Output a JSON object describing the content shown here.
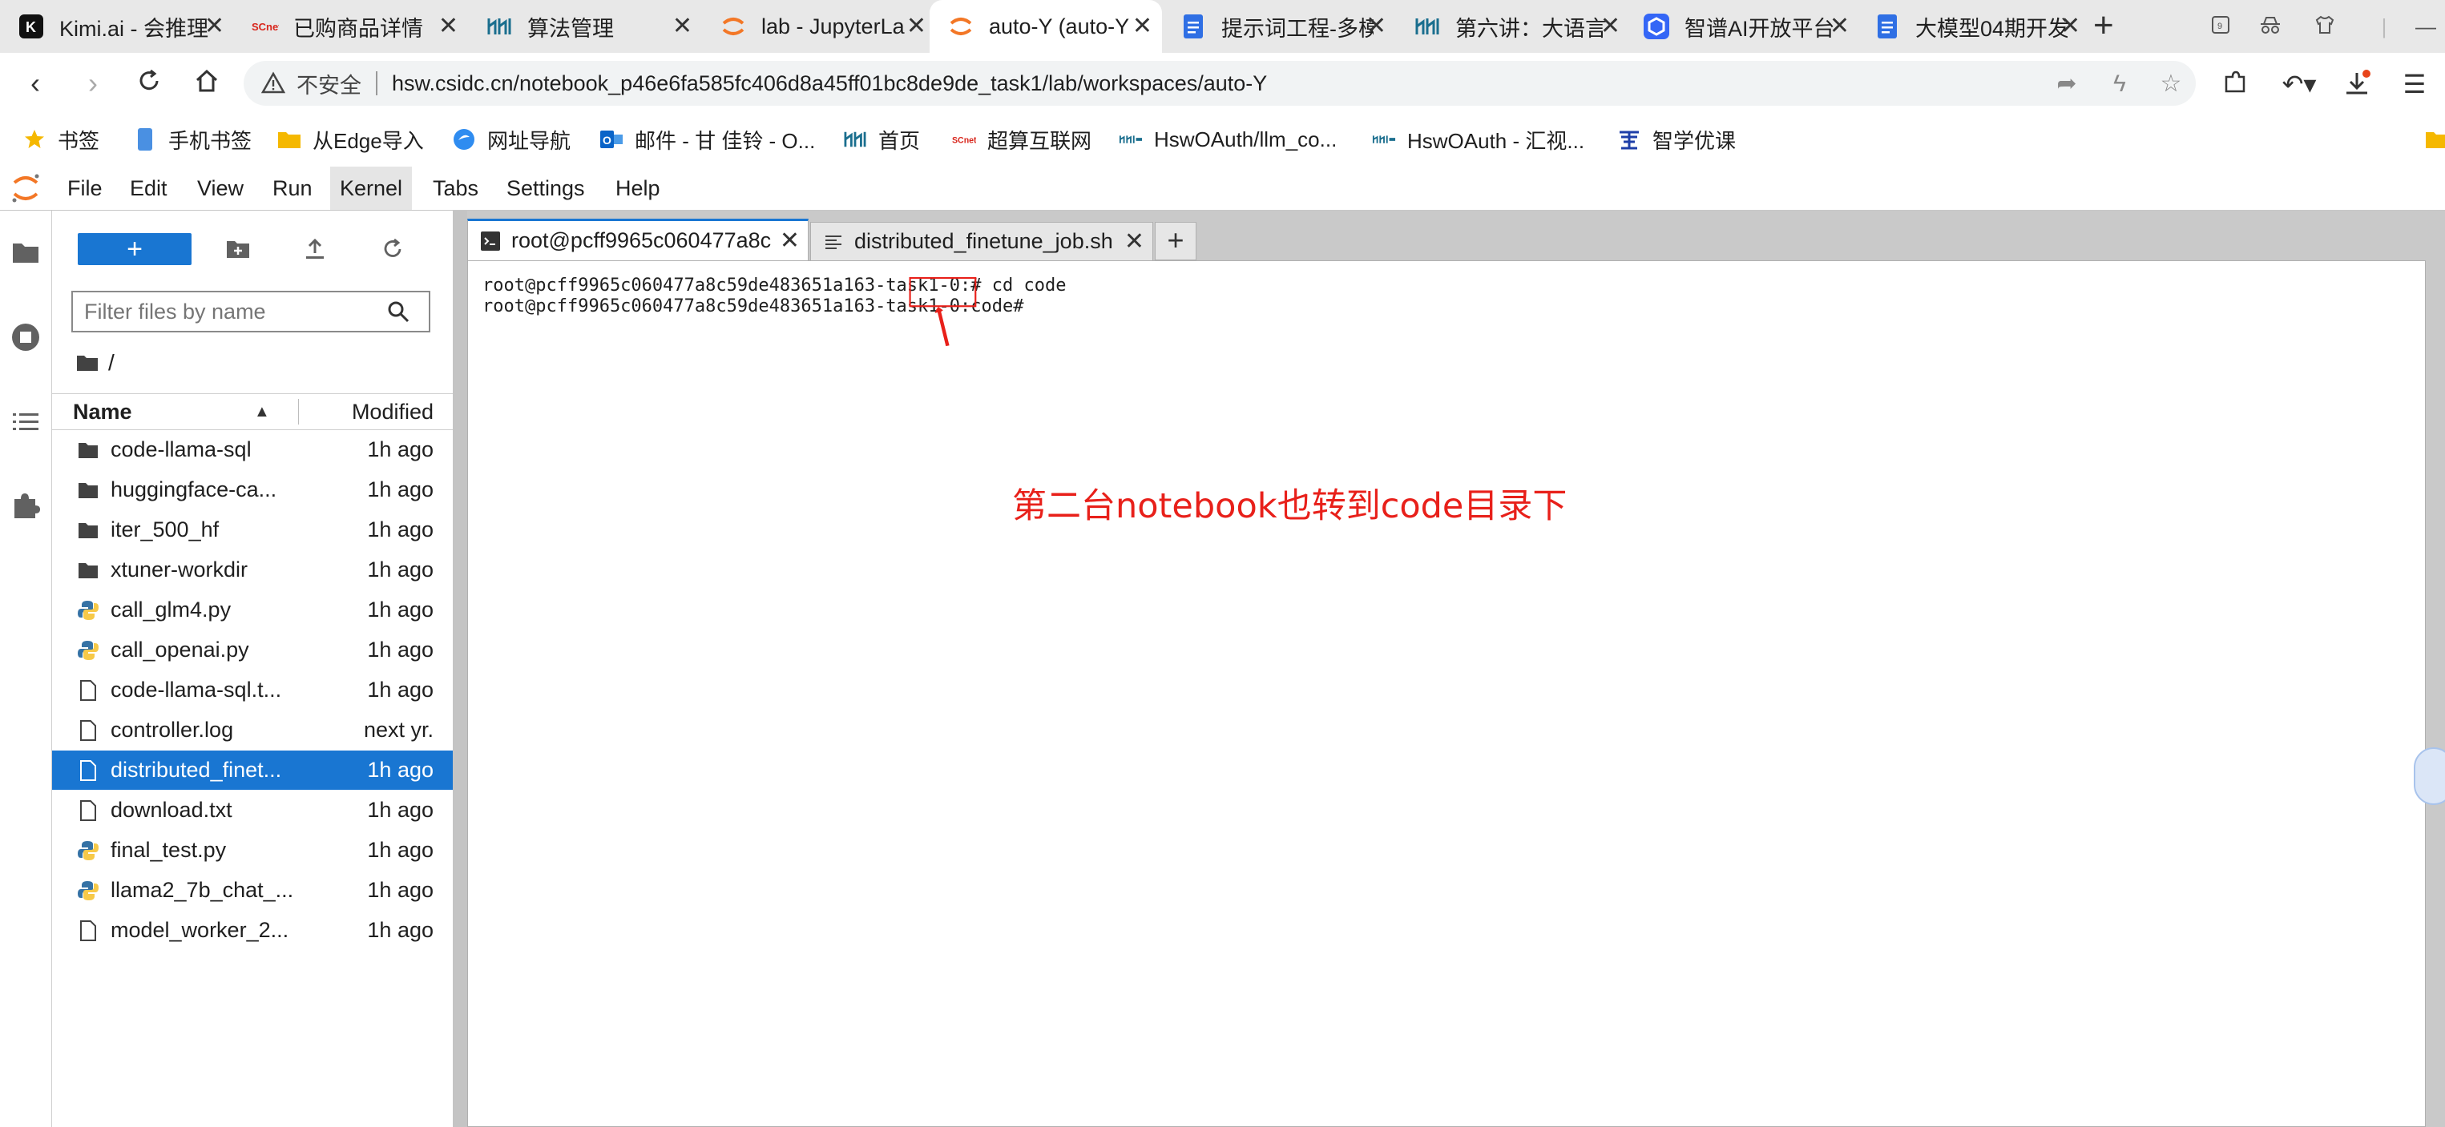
{
  "browser": {
    "tabs": [
      {
        "title": "Kimi.ai - 会推理",
        "icon": "kimi-icon"
      },
      {
        "title": "已购商品详情",
        "icon": "scnet-icon"
      },
      {
        "title": "算法管理",
        "icon": "hsw-icon"
      },
      {
        "title": "lab - JupyterLa",
        "icon": "jupyter-icon"
      },
      {
        "title": "auto-Y (auto-Y",
        "icon": "jupyter-icon",
        "active": true
      },
      {
        "title": "提示词工程-多模",
        "icon": "doc-icon"
      },
      {
        "title": "第六讲：大语言",
        "icon": "hsw-icon"
      },
      {
        "title": "智谱AI开放平台",
        "icon": "zhipu-icon"
      },
      {
        "title": "大模型04期开发",
        "icon": "doc-icon"
      }
    ],
    "address": {
      "insecure_label": "不安全",
      "url": "hsw.csidc.cn/notebook_p46e6fa585fc406d8a45ff01bc8de9de_task1/lab/workspaces/auto-Y"
    },
    "bookmarks": [
      {
        "label": "书签",
        "icon": "star-icon"
      },
      {
        "label": "手机书签",
        "icon": "phone-icon"
      },
      {
        "label": "从Edge导入",
        "icon": "folder-icon"
      },
      {
        "label": "网址导航",
        "icon": "compass-icon"
      },
      {
        "label": "邮件 - 甘 佳铃 - O...",
        "icon": "outlook-icon"
      },
      {
        "label": "首页",
        "icon": "hsw-icon"
      },
      {
        "label": "超算互联网",
        "icon": "scnet-icon"
      },
      {
        "label": "HswOAuth/llm_co...",
        "icon": "hsw-small-icon"
      },
      {
        "label": "HswOAuth - 汇视...",
        "icon": "hsw-small-icon"
      },
      {
        "label": "智学优课",
        "icon": "zhixue-icon"
      }
    ]
  },
  "menubar": [
    "File",
    "Edit",
    "View",
    "Run",
    "Kernel",
    "Tabs",
    "Settings",
    "Help"
  ],
  "filebrowser": {
    "new_label": "+",
    "filter_placeholder": "Filter files by name",
    "breadcrumb": "/",
    "col_name": "Name",
    "col_modified": "Modified",
    "files": [
      {
        "name": "code-llama-sql",
        "type": "folder",
        "modified": "1h ago"
      },
      {
        "name": "huggingface-ca...",
        "type": "folder",
        "modified": "1h ago"
      },
      {
        "name": "iter_500_hf",
        "type": "folder",
        "modified": "1h ago"
      },
      {
        "name": "xtuner-workdir",
        "type": "folder",
        "modified": "1h ago"
      },
      {
        "name": "call_glm4.py",
        "type": "python",
        "modified": "1h ago"
      },
      {
        "name": "call_openai.py",
        "type": "python",
        "modified": "1h ago"
      },
      {
        "name": "code-llama-sql.t...",
        "type": "file",
        "modified": "1h ago"
      },
      {
        "name": "controller.log",
        "type": "file",
        "modified": "next yr."
      },
      {
        "name": "distributed_finet...",
        "type": "file",
        "modified": "1h ago",
        "selected": true
      },
      {
        "name": "download.txt",
        "type": "file",
        "modified": "1h ago"
      },
      {
        "name": "final_test.py",
        "type": "python",
        "modified": "1h ago"
      },
      {
        "name": "llama2_7b_chat_...",
        "type": "python",
        "modified": "1h ago"
      },
      {
        "name": "model_worker_2...",
        "type": "file",
        "modified": "1h ago"
      }
    ]
  },
  "dock": {
    "tabs": [
      {
        "title": "root@pcff9965c060477a8c",
        "icon": "terminal-icon",
        "active": true
      },
      {
        "title": "distributed_finetune_job.sh",
        "icon": "text-file-icon"
      }
    ],
    "add_label": "+"
  },
  "terminal": {
    "lines": [
      {
        "prompt": "root@pcff9965c060477a8c59de483651a163-task1-0:",
        "text": "# cd code"
      },
      {
        "prompt": "root@pcff9965c060477a8c59de483651a163-task1-0:",
        "text": "code#"
      }
    ]
  },
  "annotation": {
    "text": "第二台notebook也转到code目录下",
    "color": "#e8201a"
  },
  "colors": {
    "accent": "#1976d2",
    "annotation": "#e8201a"
  }
}
